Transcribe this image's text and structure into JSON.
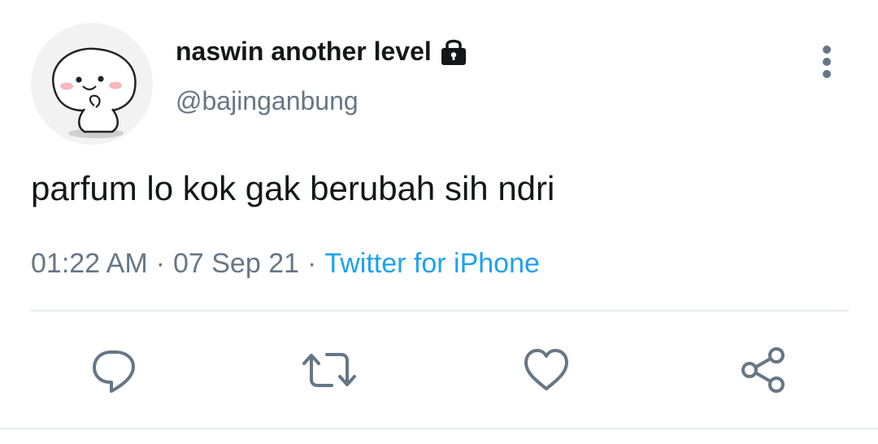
{
  "user": {
    "display_name": "naswin another level",
    "handle": "@bajinganbung",
    "protected": true,
    "avatar_icon": "cartoon-character-avatar"
  },
  "tweet": {
    "text": "parfum lo kok gak berubah sih ndri",
    "time": "01:22 AM",
    "separator": "·",
    "date": "07 Sep 21",
    "source": "Twitter for iPhone"
  },
  "icons": {
    "lock": "lock-icon",
    "more": "more-vertical-icon",
    "reply": "reply-icon",
    "retweet": "retweet-icon",
    "like": "heart-icon",
    "share": "share-icon"
  },
  "colors": {
    "text_primary": "#14171a",
    "text_secondary": "#657786",
    "link": "#1da1f2",
    "divider": "#e6ecf0"
  }
}
